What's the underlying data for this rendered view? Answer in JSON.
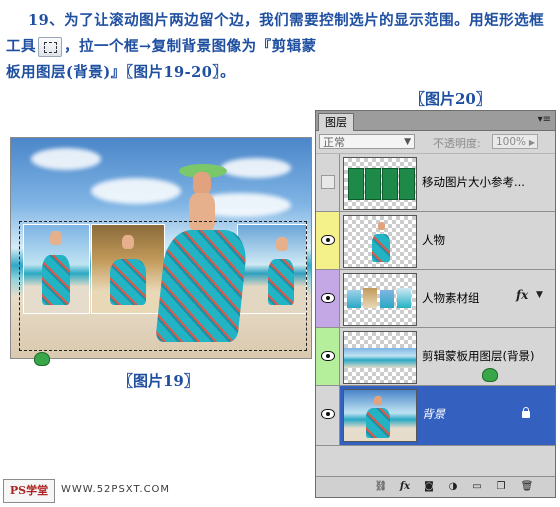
{
  "instruction": {
    "line1": "19、为了让滚动图片两边留个边，我们需要控制选片的显示范围。用矩形选框工具",
    "line1b": "，拉一个框→复制背景图像为『剪辑蒙",
    "line2": "板用图层(背景)』〖图片19-20〗。"
  },
  "captions": {
    "fig19": "〖图片19〗",
    "fig20": "〖图片20〗"
  },
  "layers_panel": {
    "tab_label": "图层",
    "blend_mode": "正常",
    "opacity_label": "不透明度:",
    "opacity_value": "100%",
    "layers": [
      {
        "name": "移动图片大小参考...",
        "visible": false,
        "tag_color": "#d6d6d6"
      },
      {
        "name": "人物",
        "visible": true,
        "tag_color": "#f4f08a"
      },
      {
        "name": "人物素材组",
        "visible": true,
        "tag_color": "#c4a8e6",
        "fx": "fx"
      },
      {
        "name": "剪辑蒙板用图层(背景)",
        "visible": true,
        "tag_color": "#b6ef9b"
      },
      {
        "name": "背景",
        "visible": true,
        "tag_color": "#3460c0",
        "selected": true
      }
    ],
    "bottom_icons": [
      "link-icon",
      "fx-icon",
      "mask-icon",
      "adjustment-icon",
      "group-icon",
      "new-layer-icon",
      "trash-icon"
    ]
  },
  "watermark": {
    "logo": "PS学堂",
    "url": "WWW.52PSXT.COM"
  }
}
